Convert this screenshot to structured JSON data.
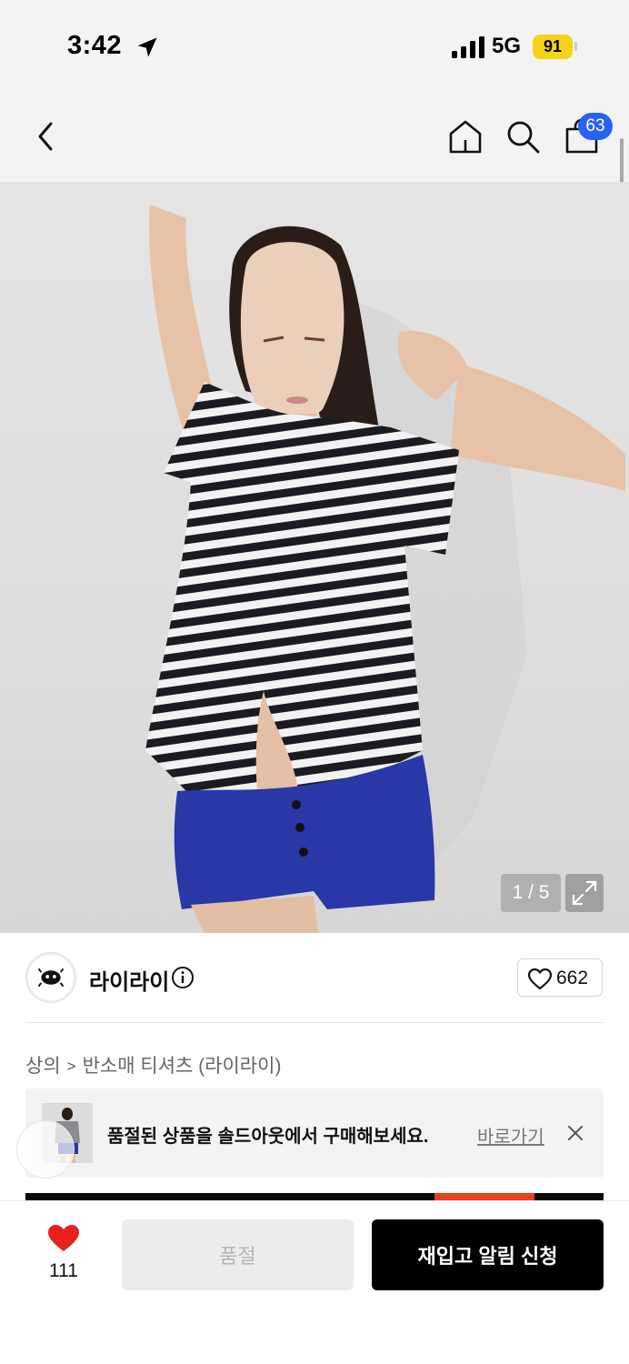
{
  "status_bar": {
    "time": "3:42",
    "network": "5G",
    "battery": "91",
    "location_icon": "location-arrow-icon",
    "signal_icon": "signal-bars-icon"
  },
  "header": {
    "back_icon": "chevron-left-icon",
    "home_icon": "home-icon",
    "search_icon": "search-icon",
    "cart_icon": "shopping-bag-icon",
    "cart_count": "63"
  },
  "gallery": {
    "counter": "1 / 5",
    "expand_icon": "expand-icon"
  },
  "brand": {
    "name": "라이라이",
    "info_icon": "info-icon",
    "like_count": "662",
    "heart_icon": "heart-outline-icon"
  },
  "breadcrumb": {
    "level1": "상의",
    "separator": ">",
    "level2": "반소매 티셔츠 (라이라이)"
  },
  "soldout_banner": {
    "message": "품절된 상품을 솔드아웃에서 구매해보세요.",
    "link_label": "바로가기",
    "close_icon": "close-icon"
  },
  "bottom_bar": {
    "wish_count": "111",
    "wish_icon": "heart-filled-icon",
    "soldout_label": "품절",
    "restock_label": "재입고 알림 신청"
  },
  "colors": {
    "badge": "#2a62f0",
    "wish_heart": "#e8201e",
    "primary_button": "#000000",
    "battery": "#f5d31a"
  }
}
